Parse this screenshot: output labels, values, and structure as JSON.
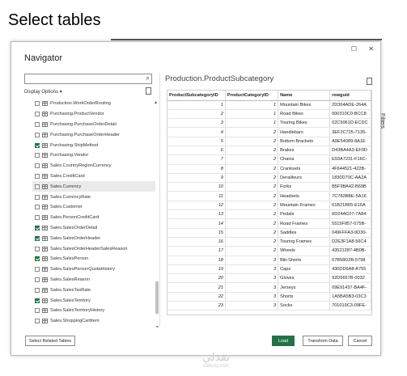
{
  "slide": {
    "title": "Select tables"
  },
  "background": {
    "filters_label": "Filters"
  },
  "navigator": {
    "title": "Navigator",
    "window_controls": {
      "restore": "☐",
      "close": "✕"
    },
    "search": {
      "value": "",
      "placeholder": ""
    },
    "display_options": "Display Options",
    "tables": [
      {
        "label": "Production.WorkOrderRouting",
        "checked": false,
        "selected": false
      },
      {
        "label": "Purchasing.ProductVendor",
        "checked": false,
        "selected": false
      },
      {
        "label": "Purchasing.PurchaseOrderDetail",
        "checked": false,
        "selected": false
      },
      {
        "label": "Purchasing.PurchaseOrderHeader",
        "checked": false,
        "selected": false
      },
      {
        "label": "Purchasing.ShipMethod",
        "checked": true,
        "selected": false
      },
      {
        "label": "Purchasing.Vendor",
        "checked": false,
        "selected": false
      },
      {
        "label": "Sales.CountryRegionCurrency",
        "checked": false,
        "selected": false
      },
      {
        "label": "Sales.CreditCard",
        "checked": false,
        "selected": false
      },
      {
        "label": "Sales.Currency",
        "checked": false,
        "selected": true
      },
      {
        "label": "Sales.CurrencyRate",
        "checked": false,
        "selected": false
      },
      {
        "label": "Sales.Customer",
        "checked": false,
        "selected": false
      },
      {
        "label": "Sales.PersonCreditCard",
        "checked": false,
        "selected": false
      },
      {
        "label": "Sales.SalesOrderDetail",
        "checked": true,
        "selected": false
      },
      {
        "label": "Sales.SalesOrderHeader",
        "checked": true,
        "selected": false
      },
      {
        "label": "Sales.SalesOrderHeaderSalesReason",
        "checked": false,
        "selected": false
      },
      {
        "label": "Sales.SalesPerson",
        "checked": true,
        "selected": false
      },
      {
        "label": "Sales.SalesPersonQuotaHistory",
        "checked": false,
        "selected": false
      },
      {
        "label": "Sales.SalesReason",
        "checked": false,
        "selected": false
      },
      {
        "label": "Sales.SalesTaxRate",
        "checked": false,
        "selected": false
      },
      {
        "label": "Sales.SalesTerritory",
        "checked": true,
        "selected": false
      },
      {
        "label": "Sales.SalesTerritoryHistory",
        "checked": false,
        "selected": false
      },
      {
        "label": "Sales.ShoppingCartItem",
        "checked": false,
        "selected": false
      }
    ],
    "preview": {
      "title": "Production.ProductSubcategory",
      "columns": [
        "ProductSubcategoryID",
        "ProductCategoryID",
        "Name",
        "rowguid"
      ],
      "rows": [
        [
          "1",
          "1",
          "Mountain Bikes",
          "2D364ADE-264A"
        ],
        [
          "2",
          "1",
          "Road Bikes",
          "000310C0-BCC8"
        ],
        [
          "3",
          "1",
          "Touring Bikes",
          "02C5061D-ECDC"
        ],
        [
          "4",
          "2",
          "Handlebars",
          "3EF2C725-7135-"
        ],
        [
          "5",
          "2",
          "Bottom Brackets",
          "A9E54089-8A1E"
        ],
        [
          "6",
          "2",
          "Brakes",
          "D43BA4A3-EF0D"
        ],
        [
          "7",
          "2",
          "Chains",
          "E93A7231-F16C-"
        ],
        [
          "8",
          "2",
          "Cranksets",
          "4F644521-422B-"
        ],
        [
          "9",
          "2",
          "Derailleurs",
          "1830D70C-AA2A"
        ],
        [
          "10",
          "2",
          "Forks",
          "B5F9BA42-B69B"
        ],
        [
          "11",
          "2",
          "Headsets",
          "7C782BBE-5A16"
        ],
        [
          "12",
          "2",
          "Mountain Frames",
          "61B21B65-E16A"
        ],
        [
          "13",
          "2",
          "Pedals",
          "6D24AC07-7A84"
        ],
        [
          "14",
          "2",
          "Road Frames",
          "5515F857-075B-"
        ],
        [
          "15",
          "2",
          "Saddles",
          "049FFFA3-9D30-"
        ],
        [
          "16",
          "2",
          "Touring Frames",
          "D2E3F1A8-56C4"
        ],
        [
          "17",
          "2",
          "Wheels",
          "43521287-4B0B-"
        ],
        [
          "18",
          "3",
          "Bib-Shorts",
          "67B58D2B-5798"
        ],
        [
          "19",
          "3",
          "Caps",
          "430DD6A8-A755"
        ],
        [
          "20",
          "3",
          "Gloves",
          "92D5657B-0032"
        ],
        [
          "21",
          "3",
          "Jerseys",
          "09E91437-BA4F-"
        ],
        [
          "22",
          "3",
          "Shorts",
          "1A5BA5B3-03C3"
        ],
        [
          "23",
          "3",
          "Socks",
          "701019C3-09FE-"
        ]
      ]
    },
    "buttons": {
      "select_related": "Select Related Tables",
      "load": "Load",
      "transform": "Transform Data",
      "cancel": "Cancel"
    }
  },
  "watermark": {
    "arabic": "نفذلي",
    "latin": "nafezly.com"
  },
  "colors": {
    "accent": "#217346"
  }
}
